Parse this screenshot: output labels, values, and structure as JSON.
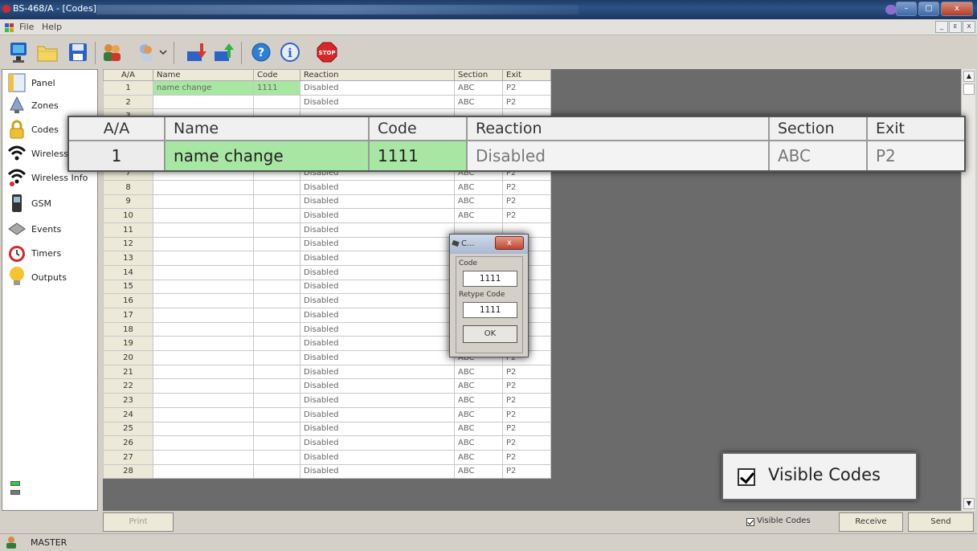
{
  "window": {
    "title": "BS-468/A - [Codes]",
    "min": "–",
    "max": "▢",
    "close": "x"
  },
  "menu": {
    "file": "File",
    "help": "Help",
    "mdi_min": "_",
    "mdi_restore": "ᴇ",
    "mdi_close": "x"
  },
  "sidebar": {
    "items": [
      {
        "label": "Panel",
        "icon": "panel-icon"
      },
      {
        "label": "Zones",
        "icon": "zones-icon"
      },
      {
        "label": "Codes",
        "icon": "lock-icon"
      },
      {
        "label": "Wireless",
        "icon": "wireless-icon"
      },
      {
        "label": "Wireless Info",
        "icon": "wireless-info-icon"
      },
      {
        "label": "GSM",
        "icon": "phone-icon"
      },
      {
        "label": "Events",
        "icon": "events-icon"
      },
      {
        "label": "Timers",
        "icon": "clock-icon"
      },
      {
        "label": "Outputs",
        "icon": "bulb-icon"
      }
    ]
  },
  "grid": {
    "columns": [
      "A/A",
      "Name",
      "Code",
      "Reaction",
      "Section",
      "Exit"
    ],
    "rows": [
      {
        "aa": "1",
        "name": "name change",
        "code": "1111",
        "reaction": "Disabled",
        "section": "ABC",
        "exit": "P2"
      },
      {
        "aa": "2",
        "name": "",
        "code": "",
        "reaction": "Disabled",
        "section": "ABC",
        "exit": "P2"
      },
      {
        "aa": "3",
        "name": "",
        "code": "",
        "reaction": "",
        "section": "",
        "exit": ""
      },
      {
        "aa": "4",
        "name": "",
        "code": "",
        "reaction": "",
        "section": "",
        "exit": ""
      },
      {
        "aa": "5",
        "name": "",
        "code": "",
        "reaction": "",
        "section": "",
        "exit": ""
      },
      {
        "aa": "6",
        "name": "",
        "code": "",
        "reaction": "",
        "section": "",
        "exit": ""
      },
      {
        "aa": "7",
        "name": "",
        "code": "",
        "reaction": "Disabled",
        "section": "ABC",
        "exit": "P2"
      },
      {
        "aa": "8",
        "name": "",
        "code": "",
        "reaction": "Disabled",
        "section": "ABC",
        "exit": "P2"
      },
      {
        "aa": "9",
        "name": "",
        "code": "",
        "reaction": "Disabled",
        "section": "ABC",
        "exit": "P2"
      },
      {
        "aa": "10",
        "name": "",
        "code": "",
        "reaction": "Disabled",
        "section": "ABC",
        "exit": "P2"
      },
      {
        "aa": "11",
        "name": "",
        "code": "",
        "reaction": "Disabled",
        "section": "",
        "exit": ""
      },
      {
        "aa": "12",
        "name": "",
        "code": "",
        "reaction": "Disabled",
        "section": "",
        "exit": ""
      },
      {
        "aa": "13",
        "name": "",
        "code": "",
        "reaction": "Disabled",
        "section": "",
        "exit": ""
      },
      {
        "aa": "14",
        "name": "",
        "code": "",
        "reaction": "Disabled",
        "section": "",
        "exit": ""
      },
      {
        "aa": "15",
        "name": "",
        "code": "",
        "reaction": "Disabled",
        "section": "",
        "exit": ""
      },
      {
        "aa": "16",
        "name": "",
        "code": "",
        "reaction": "Disabled",
        "section": "",
        "exit": ""
      },
      {
        "aa": "17",
        "name": "",
        "code": "",
        "reaction": "Disabled",
        "section": "",
        "exit": ""
      },
      {
        "aa": "18",
        "name": "",
        "code": "",
        "reaction": "Disabled",
        "section": "",
        "exit": ""
      },
      {
        "aa": "19",
        "name": "",
        "code": "",
        "reaction": "Disabled",
        "section": "ABC",
        "exit": "P2"
      },
      {
        "aa": "20",
        "name": "",
        "code": "",
        "reaction": "Disabled",
        "section": "ABC",
        "exit": "P2"
      },
      {
        "aa": "21",
        "name": "",
        "code": "",
        "reaction": "Disabled",
        "section": "ABC",
        "exit": "P2"
      },
      {
        "aa": "22",
        "name": "",
        "code": "",
        "reaction": "Disabled",
        "section": "ABC",
        "exit": "P2"
      },
      {
        "aa": "23",
        "name": "",
        "code": "",
        "reaction": "Disabled",
        "section": "ABC",
        "exit": "P2"
      },
      {
        "aa": "24",
        "name": "",
        "code": "",
        "reaction": "Disabled",
        "section": "ABC",
        "exit": "P2"
      },
      {
        "aa": "25",
        "name": "",
        "code": "",
        "reaction": "Disabled",
        "section": "ABC",
        "exit": "P2"
      },
      {
        "aa": "26",
        "name": "",
        "code": "",
        "reaction": "Disabled",
        "section": "ABC",
        "exit": "P2"
      },
      {
        "aa": "27",
        "name": "",
        "code": "",
        "reaction": "Disabled",
        "section": "ABC",
        "exit": "P2"
      },
      {
        "aa": "28",
        "name": "",
        "code": "",
        "reaction": "Disabled",
        "section": "ABC",
        "exit": "P2"
      }
    ]
  },
  "zoom": {
    "headers": [
      "A/A",
      "Name",
      "Code",
      "Reaction",
      "Section",
      "Exit"
    ],
    "row": {
      "aa": "1",
      "name": "name change",
      "code": "1111",
      "reaction": "Disabled",
      "section": "ABC",
      "exit": "P2"
    }
  },
  "dialog": {
    "title": "C...",
    "close": "x",
    "code_label": "Code",
    "code_value": "1111",
    "retype_label": "Retype Code",
    "retype_value": "1111",
    "ok": "OK"
  },
  "bottom": {
    "print": "Print",
    "visible_codes": "Visible Codes",
    "receive": "Receive",
    "send": "Send"
  },
  "visible_codes_zoom": "Visible Codes",
  "status": {
    "user": "MASTER"
  },
  "colors": {
    "highlight_green": "#a8e6a3",
    "titlebar": "#2c5387",
    "led_green": "#2ecc40"
  }
}
